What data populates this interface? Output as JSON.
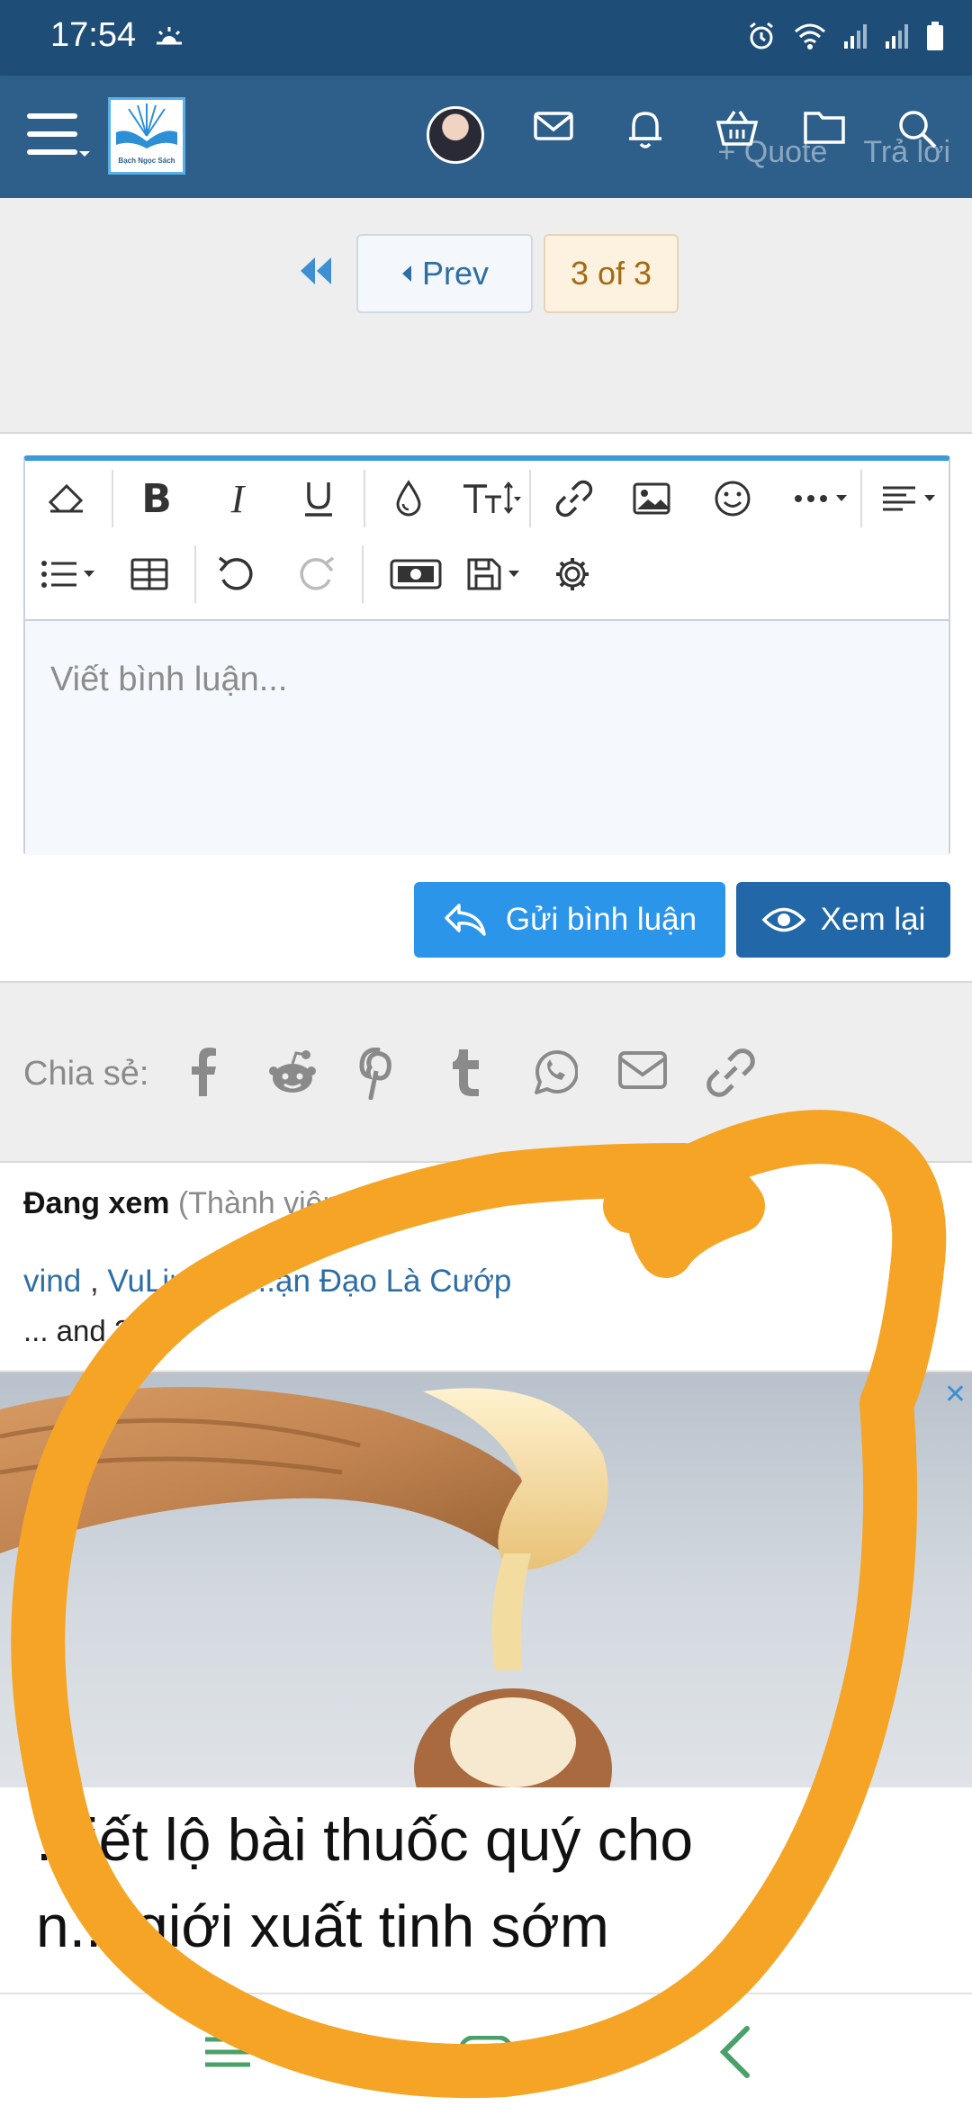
{
  "status_bar": {
    "time": "17:54"
  },
  "header": {
    "logo_text": "Bạch Ngọc Sách",
    "quote_label": "+ Quote",
    "reply_label": "Trả lời",
    "icons": [
      "menu-icon",
      "avatar",
      "mail-icon",
      "bell-icon",
      "basket-icon",
      "folder-icon",
      "search-icon"
    ]
  },
  "pagination": {
    "prev_label": "Prev",
    "page_indicator": "3 of 3"
  },
  "editor": {
    "placeholder": "Viết bình luận...",
    "submit_label": "Gửi bình luận",
    "preview_label": "Xem lại"
  },
  "share": {
    "label": "Chia sẻ:",
    "icons": [
      "facebook-icon",
      "reddit-icon",
      "pinterest-icon",
      "tumblr-icon",
      "whatsapp-icon",
      "email-icon",
      "link-icon"
    ]
  },
  "viewers": {
    "title": "Đang xem",
    "subtitle": "(Thành viên: 5, Kh",
    "names": [
      "vind",
      "VuLinh",
      "...ạn Đạo Là Cướp"
    ],
    "more": "... and 2"
  },
  "ad": {
    "close": "✕",
    "headline_line1": "...iết lộ bài thuốc quý cho",
    "headline_line2": "n... giới xuất tinh sớm"
  },
  "colors": {
    "header": "#2d5f8a",
    "status_bar": "#1e4e78",
    "primary_button": "#2b95ea",
    "secondary_button": "#2268a8",
    "annotation": "#f6a425"
  }
}
